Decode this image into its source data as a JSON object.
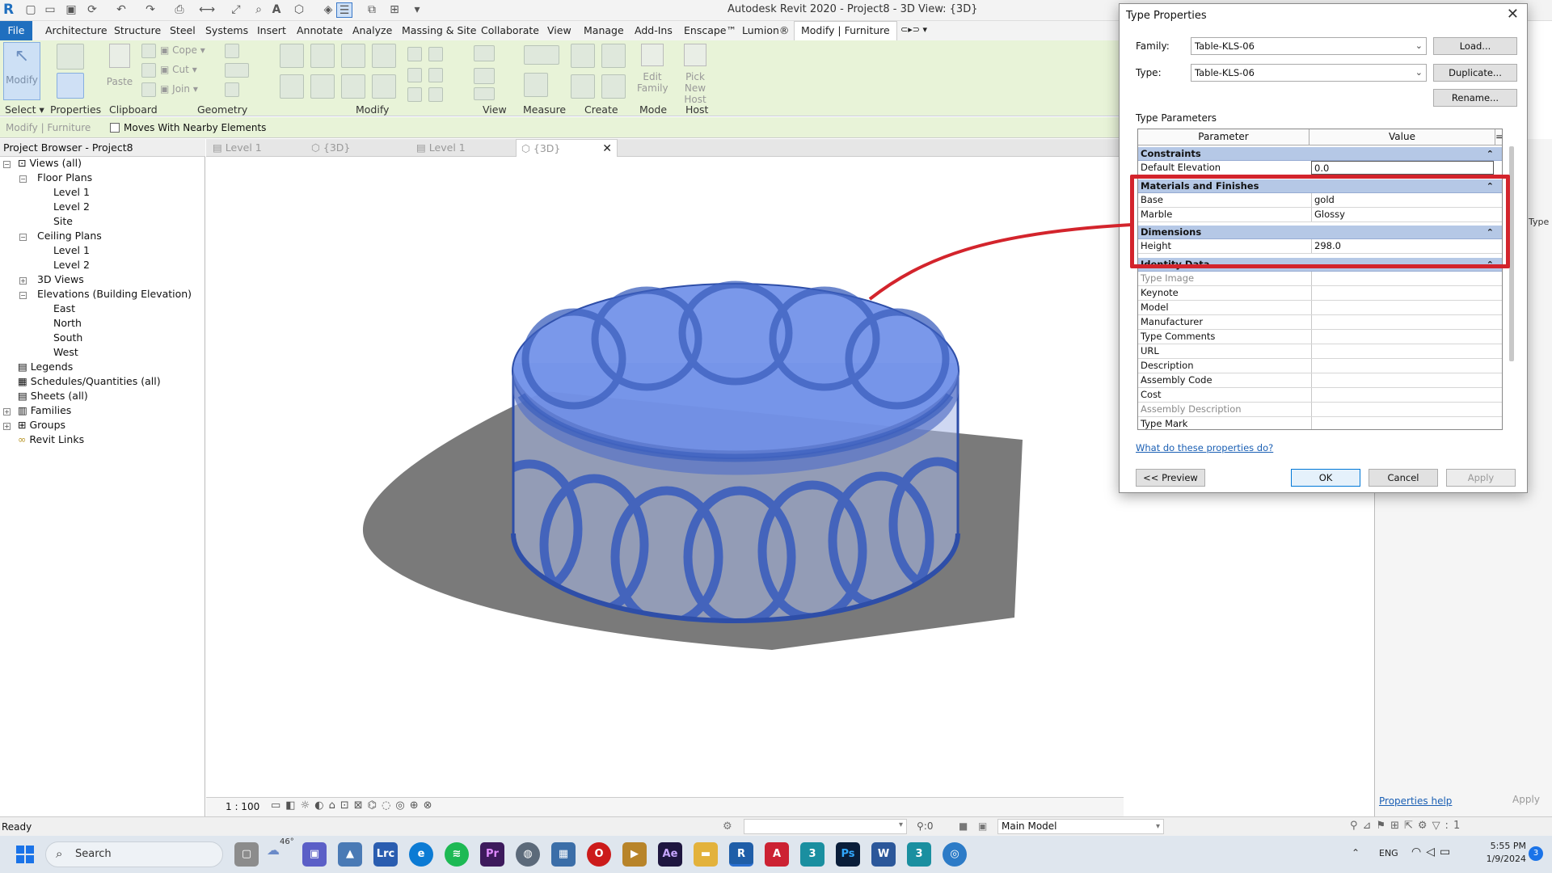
{
  "window_title": "Autodesk Revit 2020 - Project8 - 3D View: {3D}",
  "ribbon_tabs": [
    "File",
    "Architecture",
    "Structure",
    "Steel",
    "Systems",
    "Insert",
    "Annotate",
    "Analyze",
    "Massing & Site",
    "Collaborate",
    "View",
    "Manage",
    "Add-Ins",
    "Enscape™",
    "Lumion®",
    "Modify | Furniture"
  ],
  "ribbon_panels": {
    "select": "Select",
    "properties": "Properties",
    "clipboard": "Clipboard",
    "geometry": "Geometry",
    "modify": "Modify",
    "view": "View",
    "measure": "Measure",
    "create": "Create",
    "mode": "Mode",
    "host": "Host"
  },
  "ribbon_buttons": {
    "modify": "Modify",
    "paste": "Paste",
    "cope": "Cope",
    "cut": "Cut",
    "join": "Join",
    "edit_family": "Edit Family",
    "pick_new_host": "Pick New Host"
  },
  "options_bar": {
    "context": "Modify | Furniture",
    "moves_with_nearby": "Moves With Nearby Elements"
  },
  "project_browser": {
    "title": "Project Browser - Project8",
    "items": {
      "views_all": "Views (all)",
      "floor_plans": "Floor Plans",
      "fp_level1": "Level 1",
      "fp_level2": "Level 2",
      "fp_site": "Site",
      "ceiling_plans": "Ceiling Plans",
      "cp_level1": "Level 1",
      "cp_level2": "Level 2",
      "views_3d": "3D Views",
      "elevations": "Elevations (Building Elevation)",
      "east": "East",
      "north": "North",
      "south": "South",
      "west": "West",
      "legends": "Legends",
      "schedules": "Schedules/Quantities (all)",
      "sheets": "Sheets (all)",
      "families": "Families",
      "groups": "Groups",
      "revit_links": "Revit Links"
    }
  },
  "view_tabs": [
    "Level 1",
    "{3D}",
    "Level 1",
    "{3D}"
  ],
  "view_scale": "1 : 100",
  "status": {
    "ready": "Ready",
    "zero": ":0",
    "model": "Main Model"
  },
  "properties_side": {
    "help": "Properties help",
    "apply": "Apply",
    "type_snip": "Type"
  },
  "dialog": {
    "title": "Type Properties",
    "family_label": "Family:",
    "family_value": "Table-KLS-06",
    "type_label": "Type:",
    "type_value": "Table-KLS-06",
    "load": "Load...",
    "duplicate": "Duplicate...",
    "rename": "Rename...",
    "type_parameters": "Type Parameters",
    "col_parameter": "Parameter",
    "col_value": "Value",
    "col_eq": "=",
    "groups": {
      "constraints": "Constraints",
      "materials": "Materials and Finishes",
      "dimensions": "Dimensions",
      "identity": "Identity Data"
    },
    "rows": {
      "default_elevation": {
        "p": "Default Elevation",
        "v": "0.0"
      },
      "base": {
        "p": "Base",
        "v": "gold"
      },
      "marble": {
        "p": "Marble",
        "v": "Glossy"
      },
      "height": {
        "p": "Height",
        "v": "298.0"
      },
      "type_image": {
        "p": "Type Image",
        "v": ""
      },
      "keynote": {
        "p": "Keynote",
        "v": ""
      },
      "model": {
        "p": "Model",
        "v": ""
      },
      "manufacturer": {
        "p": "Manufacturer",
        "v": ""
      },
      "type_comments": {
        "p": "Type Comments",
        "v": ""
      },
      "url": {
        "p": "URL",
        "v": ""
      },
      "description": {
        "p": "Description",
        "v": ""
      },
      "assembly_code": {
        "p": "Assembly Code",
        "v": ""
      },
      "cost": {
        "p": "Cost",
        "v": ""
      },
      "assembly_description": {
        "p": "Assembly Description",
        "v": ""
      },
      "type_mark": {
        "p": "Type Mark",
        "v": ""
      }
    },
    "help_link": "What do these properties do?",
    "preview": "<< Preview",
    "ok": "OK",
    "cancel": "Cancel",
    "apply": "Apply"
  },
  "taskbar": {
    "search": "Search",
    "weather": "46°",
    "lang": "ENG",
    "time": "5:55 PM",
    "date": "1/9/2024",
    "notif": "3",
    "icons": [
      "Lrc",
      "Pr",
      "Ae",
      "Ps"
    ]
  },
  "colors": {
    "ribbon_bg": "#e8f3d8",
    "file_tab": "#1f6fbf",
    "table_blue": "#6f8fe8",
    "group_header": "#b5c8e6",
    "highlight": "#d3242c"
  }
}
